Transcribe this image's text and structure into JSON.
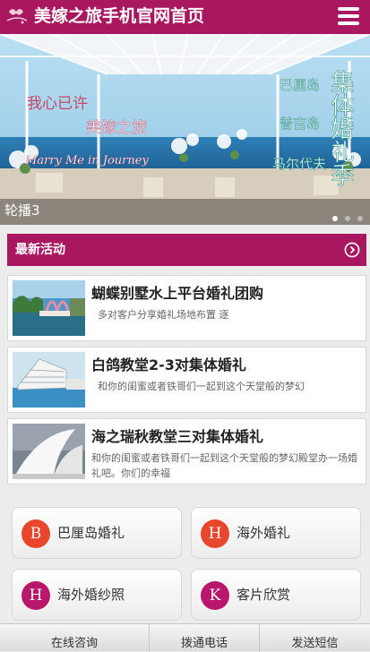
{
  "header": {
    "title": "美嫁之旅手机官网首页"
  },
  "banner": {
    "caption": "轮播3",
    "slide_count": 3,
    "active_index": 0,
    "overlay": {
      "line1": "我心已许",
      "line2": "美嫁之旅",
      "line3": "Marry Me in Journey",
      "place1": "巴厘岛",
      "place2": "普吉岛",
      "place3": "马尔代夫",
      "vertical": "集体婚礼季"
    }
  },
  "section": {
    "title": "最新活动"
  },
  "activities": [
    {
      "title": "蝴蝶别墅水上平台婚礼团购",
      "desc": "多对客户分享婚礼场地布置 逐"
    },
    {
      "title": "白鸽教堂2-3对集体婚礼",
      "desc": "和你的闺蜜或者铁哥们一起到这个天堂般的梦幻"
    },
    {
      "title": "海之瑞秋教堂三对集体婚礼",
      "desc": "和你的闺蜜或者铁哥们一起到这个天堂般的梦幻殿堂办一场婚礼吧。你们的幸福"
    }
  ],
  "services": [
    {
      "letter": "B",
      "label": "巴厘岛婚礼",
      "color": "#e8462d"
    },
    {
      "letter": "H",
      "label": "海外婚礼",
      "color": "#e8462d"
    },
    {
      "letter": "H",
      "label": "海外婚纱照",
      "color": "#b8176c"
    },
    {
      "letter": "K",
      "label": "客片欣赏",
      "color": "#b8176c"
    }
  ],
  "bottom_bar": {
    "items": [
      "在线咨询",
      "拨通电话",
      "发送短信"
    ]
  },
  "colors": {
    "brand": "#a8175f"
  }
}
